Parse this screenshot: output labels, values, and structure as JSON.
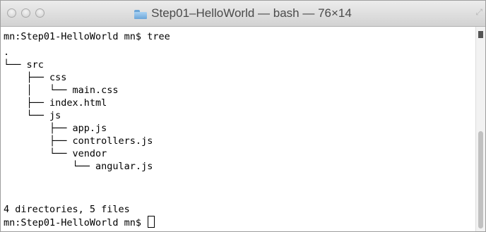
{
  "window": {
    "title": "Step01–HelloWorld — bash — 76×14"
  },
  "terminal": {
    "lines": [
      "mn:Step01-HelloWorld mn$ tree",
      ".",
      "└── src",
      "    ├── css",
      "    │   └── main.css",
      "    ├── index.html",
      "    └── js",
      "        ├── app.js",
      "        ├── controllers.js",
      "        └── vendor",
      "            └── angular.js",
      "",
      "4 directories, 5 files",
      "mn:Step01-HelloWorld mn$ "
    ]
  },
  "icons": {
    "title_folder": "folder-icon",
    "fullscreen": "fullscreen-icon"
  },
  "colors": {
    "background": "#ffffff",
    "text": "#000000",
    "titlebar": "#dcdcdc"
  }
}
